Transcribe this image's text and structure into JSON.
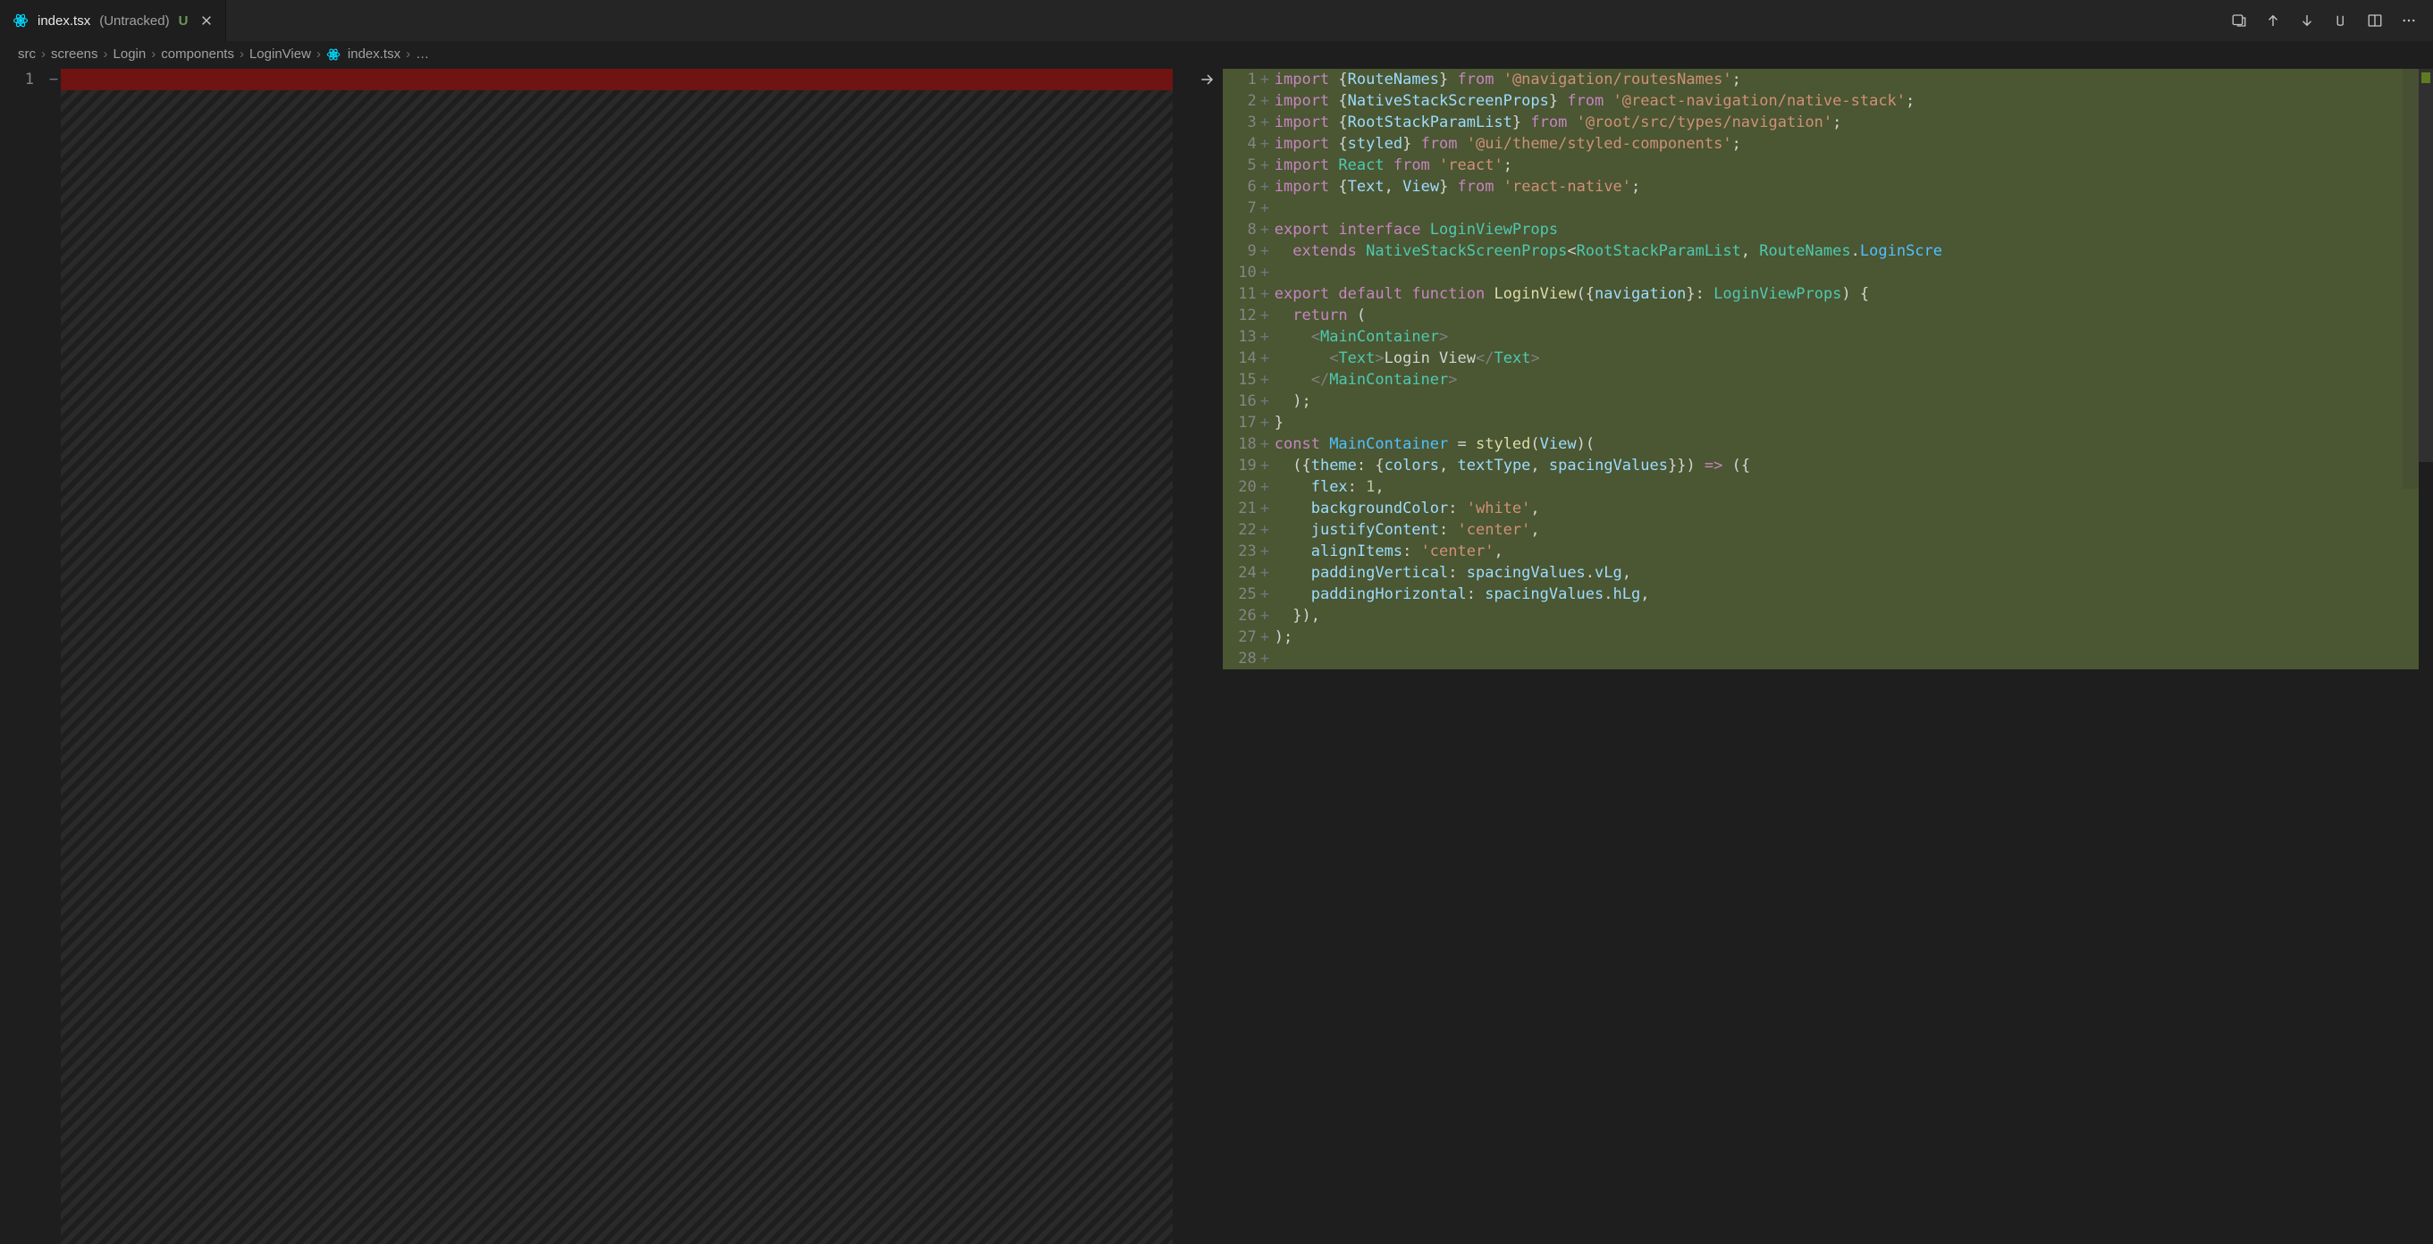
{
  "tab": {
    "filename": "index.tsx",
    "hint": "(Untracked)",
    "badge": "U"
  },
  "breadcrumb": {
    "parts": [
      "src",
      "screens",
      "Login",
      "components",
      "LoginView",
      "index.tsx",
      "…"
    ]
  },
  "left": {
    "line_no": "1",
    "sign": "−"
  },
  "code": [
    {
      "n": "1",
      "tok": [
        [
          "k",
          "import "
        ],
        [
          "p",
          "{"
        ],
        [
          "v",
          "RouteNames"
        ],
        [
          "p",
          "}"
        ],
        [
          "k",
          " from "
        ],
        [
          "s",
          "'@navigation/routesNames'"
        ],
        [
          "p",
          ";"
        ]
      ]
    },
    {
      "n": "2",
      "tok": [
        [
          "k",
          "import "
        ],
        [
          "p",
          "{"
        ],
        [
          "v",
          "NativeStackScreenProps"
        ],
        [
          "p",
          "}"
        ],
        [
          "k",
          " from "
        ],
        [
          "s",
          "'@react-navigation/native-stack'"
        ],
        [
          "p",
          ";"
        ]
      ]
    },
    {
      "n": "3",
      "tok": [
        [
          "k",
          "import "
        ],
        [
          "p",
          "{"
        ],
        [
          "v",
          "RootStackParamList"
        ],
        [
          "p",
          "}"
        ],
        [
          "k",
          " from "
        ],
        [
          "s",
          "'@root/src/types/navigation'"
        ],
        [
          "p",
          ";"
        ]
      ]
    },
    {
      "n": "4",
      "tok": [
        [
          "k",
          "import "
        ],
        [
          "p",
          "{"
        ],
        [
          "v",
          "styled"
        ],
        [
          "p",
          "}"
        ],
        [
          "k",
          " from "
        ],
        [
          "s",
          "'@ui/theme/styled-components'"
        ],
        [
          "p",
          ";"
        ]
      ]
    },
    {
      "n": "5",
      "tok": [
        [
          "k",
          "import "
        ],
        [
          "t",
          "React"
        ],
        [
          "k",
          " from "
        ],
        [
          "s",
          "'react'"
        ],
        [
          "p",
          ";"
        ]
      ]
    },
    {
      "n": "6",
      "tok": [
        [
          "k",
          "import "
        ],
        [
          "p",
          "{"
        ],
        [
          "v",
          "Text"
        ],
        [
          "p",
          ", "
        ],
        [
          "v",
          "View"
        ],
        [
          "p",
          "}"
        ],
        [
          "k",
          " from "
        ],
        [
          "s",
          "'react-native'"
        ],
        [
          "p",
          ";"
        ]
      ]
    },
    {
      "n": "7",
      "tok": [
        [
          "d",
          ""
        ]
      ]
    },
    {
      "n": "8",
      "tok": [
        [
          "k",
          "export "
        ],
        [
          "k",
          "interface "
        ],
        [
          "t",
          "LoginViewProps"
        ]
      ]
    },
    {
      "n": "9",
      "tok": [
        [
          "d",
          "  "
        ],
        [
          "k",
          "extends "
        ],
        [
          "t",
          "NativeStackScreenProps"
        ],
        [
          "p",
          "<"
        ],
        [
          "t",
          "RootStackParamList"
        ],
        [
          "p",
          ", "
        ],
        [
          "t",
          "RouteNames"
        ],
        [
          "p",
          "."
        ],
        [
          "c",
          "LoginScre"
        ]
      ]
    },
    {
      "n": "10",
      "tok": [
        [
          "d",
          ""
        ]
      ]
    },
    {
      "n": "11",
      "tok": [
        [
          "k",
          "export "
        ],
        [
          "k",
          "default "
        ],
        [
          "k",
          "function "
        ],
        [
          "f",
          "LoginView"
        ],
        [
          "p",
          "({"
        ],
        [
          "v",
          "navigation"
        ],
        [
          "p",
          "}: "
        ],
        [
          "t",
          "LoginViewProps"
        ],
        [
          "p",
          ") {"
        ]
      ]
    },
    {
      "n": "12",
      "tok": [
        [
          "d",
          "  "
        ],
        [
          "k",
          "return"
        ],
        [
          "d",
          " ("
        ]
      ]
    },
    {
      "n": "13",
      "tok": [
        [
          "d",
          "    "
        ],
        [
          "tp",
          "<"
        ],
        [
          "tg",
          "MainContainer"
        ],
        [
          "tp",
          ">"
        ]
      ]
    },
    {
      "n": "14",
      "tok": [
        [
          "d",
          "      "
        ],
        [
          "tp",
          "<"
        ],
        [
          "tg",
          "Text"
        ],
        [
          "tp",
          ">"
        ],
        [
          "d",
          "Login View"
        ],
        [
          "tp",
          "</"
        ],
        [
          "tg",
          "Text"
        ],
        [
          "tp",
          ">"
        ]
      ]
    },
    {
      "n": "15",
      "tok": [
        [
          "d",
          "    "
        ],
        [
          "tp",
          "</"
        ],
        [
          "tg",
          "MainContainer"
        ],
        [
          "tp",
          ">"
        ]
      ]
    },
    {
      "n": "16",
      "tok": [
        [
          "d",
          "  );"
        ]
      ]
    },
    {
      "n": "17",
      "tok": [
        [
          "p",
          "}"
        ]
      ]
    },
    {
      "n": "18",
      "tok": [
        [
          "k",
          "const "
        ],
        [
          "c",
          "MainContainer"
        ],
        [
          "d",
          " = "
        ],
        [
          "f",
          "styled"
        ],
        [
          "p",
          "("
        ],
        [
          "v",
          "View"
        ],
        [
          "p",
          ")("
        ]
      ]
    },
    {
      "n": "19",
      "tok": [
        [
          "d",
          "  ({"
        ],
        [
          "v",
          "theme"
        ],
        [
          "p",
          ": {"
        ],
        [
          "v",
          "colors"
        ],
        [
          "p",
          ", "
        ],
        [
          "v",
          "textType"
        ],
        [
          "p",
          ", "
        ],
        [
          "v",
          "spacingValues"
        ],
        [
          "p",
          "}}) "
        ],
        [
          "k",
          "=>"
        ],
        [
          "p",
          " ({"
        ]
      ]
    },
    {
      "n": "20",
      "tok": [
        [
          "d",
          "    "
        ],
        [
          "v",
          "flex"
        ],
        [
          "p",
          ": "
        ],
        [
          "n",
          "1"
        ],
        [
          "p",
          ","
        ]
      ]
    },
    {
      "n": "21",
      "tok": [
        [
          "d",
          "    "
        ],
        [
          "v",
          "backgroundColor"
        ],
        [
          "p",
          ": "
        ],
        [
          "s",
          "'white'"
        ],
        [
          "p",
          ","
        ]
      ]
    },
    {
      "n": "22",
      "tok": [
        [
          "d",
          "    "
        ],
        [
          "v",
          "justifyContent"
        ],
        [
          "p",
          ": "
        ],
        [
          "s",
          "'center'"
        ],
        [
          "p",
          ","
        ]
      ]
    },
    {
      "n": "23",
      "tok": [
        [
          "d",
          "    "
        ],
        [
          "v",
          "alignItems"
        ],
        [
          "p",
          ": "
        ],
        [
          "s",
          "'center'"
        ],
        [
          "p",
          ","
        ]
      ]
    },
    {
      "n": "24",
      "tok": [
        [
          "d",
          "    "
        ],
        [
          "v",
          "paddingVertical"
        ],
        [
          "p",
          ": "
        ],
        [
          "v",
          "spacingValues"
        ],
        [
          "p",
          "."
        ],
        [
          "v",
          "vLg"
        ],
        [
          "p",
          ","
        ]
      ]
    },
    {
      "n": "25",
      "tok": [
        [
          "d",
          "    "
        ],
        [
          "v",
          "paddingHorizontal"
        ],
        [
          "p",
          ": "
        ],
        [
          "v",
          "spacingValues"
        ],
        [
          "p",
          "."
        ],
        [
          "v",
          "hLg"
        ],
        [
          "p",
          ","
        ]
      ]
    },
    {
      "n": "26",
      "tok": [
        [
          "d",
          "  }),"
        ]
      ]
    },
    {
      "n": "27",
      "tok": [
        [
          "d",
          ");"
        ]
      ]
    },
    {
      "n": "28",
      "tok": [
        [
          "d",
          ""
        ]
      ]
    }
  ]
}
